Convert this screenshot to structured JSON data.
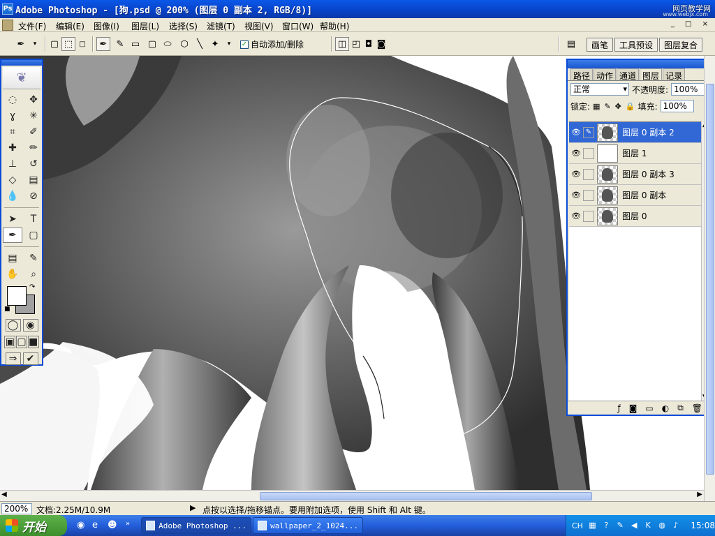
{
  "window": {
    "title": "Adobe Photoshop - [狗.psd @ 200% (图层 0 副本 2, RGB/8)]",
    "watermark": "网页教学网",
    "watermark_url": "www.webjx.com"
  },
  "menu": [
    "文件(F)",
    "编辑(E)",
    "图像(I)",
    "图层(L)",
    "选择(S)",
    "滤镜(T)",
    "视图(V)",
    "窗口(W)",
    "帮助(H)"
  ],
  "options_bar": {
    "auto_add_delete_label": "自动添加/删除",
    "auto_add_delete_checked": true,
    "palette_well_tabs": [
      "画笔",
      "工具预设",
      "图层复合"
    ]
  },
  "layers_panel": {
    "tabs": [
      "路径",
      "动作",
      "通道",
      "图层",
      "记录"
    ],
    "active_tab": "图层",
    "blend_mode": "正常",
    "opacity_label": "不透明度:",
    "opacity_value": "100%",
    "lock_label": "锁定:",
    "fill_label": "填充:",
    "fill_value": "100%",
    "layers": [
      {
        "name": "图层 0 副本 2",
        "selected": true,
        "thumb": "figure"
      },
      {
        "name": "图层 1",
        "selected": false,
        "thumb": "white"
      },
      {
        "name": "图层 0 副本 3",
        "selected": false,
        "thumb": "figure"
      },
      {
        "name": "图层 0 副本",
        "selected": false,
        "thumb": "figure"
      },
      {
        "name": "图层 0",
        "selected": false,
        "thumb": "figure"
      }
    ]
  },
  "status_bar": {
    "zoom": "200%",
    "doc_info": "文档:2.25M/10.9M",
    "hint": "点按以选择/拖移锚点。要用附加选项，使用 Shift 和 Alt 键。"
  },
  "taskbar": {
    "start_label": "开始",
    "tasks": [
      "Adobe Photoshop ...",
      "wallpaper_2_1024..."
    ],
    "tray_lang": "CH",
    "clock": "15:08"
  }
}
